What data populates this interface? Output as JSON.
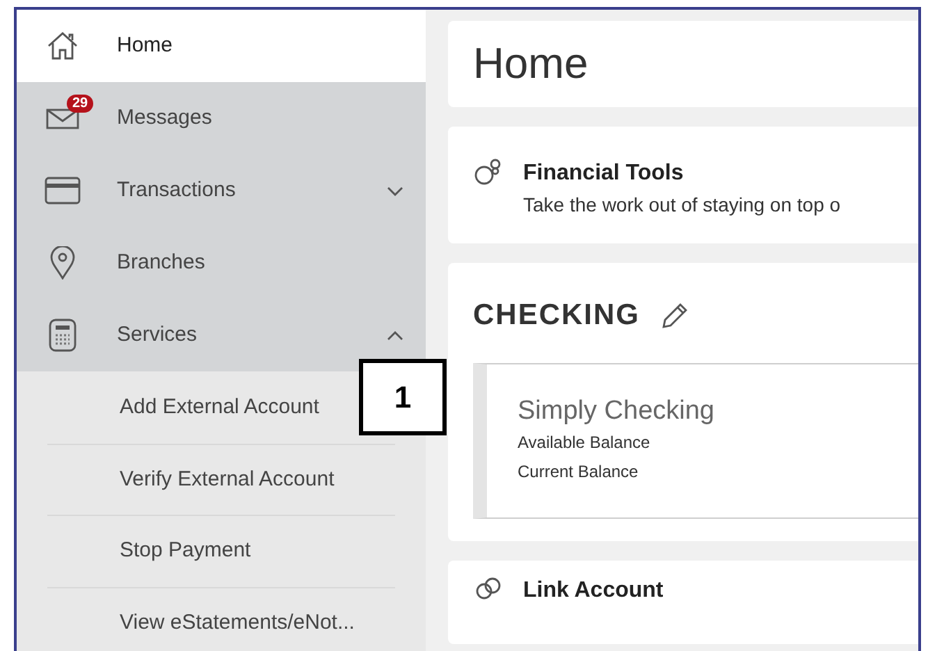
{
  "sidebar": {
    "items": [
      {
        "label": "Home",
        "selected": true
      },
      {
        "label": "Messages",
        "selected": false,
        "badge": "29"
      },
      {
        "label": "Transactions",
        "selected": false,
        "expanded": false
      },
      {
        "label": "Branches",
        "selected": false
      },
      {
        "label": "Services",
        "selected": false,
        "expanded": true,
        "children": [
          {
            "label": "Add External Account"
          },
          {
            "label": "Verify External Account"
          },
          {
            "label": "Stop Payment"
          },
          {
            "label": "View eStatements/eNot..."
          }
        ]
      }
    ]
  },
  "page_title": "Home",
  "financial_tools": {
    "title": "Financial Tools",
    "description": "Take the work out of staying on top o"
  },
  "checking": {
    "title": "CHECKING",
    "accounts": [
      {
        "name": "Simply Checking",
        "lines": [
          "Available Balance",
          "Current Balance"
        ]
      }
    ]
  },
  "link_account": {
    "title": "Link Account"
  },
  "callout": {
    "label": "1"
  }
}
